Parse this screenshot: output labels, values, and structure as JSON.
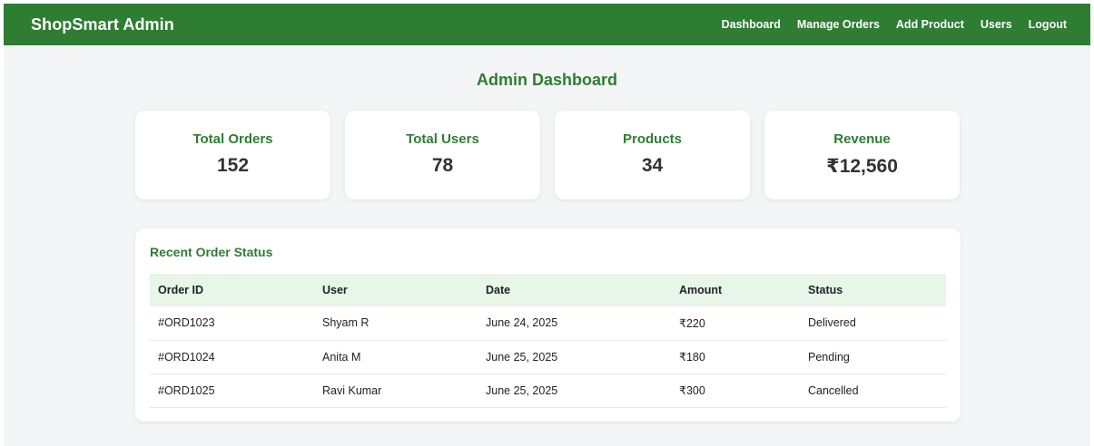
{
  "navbar": {
    "brand": "ShopSmart Admin",
    "links": [
      "Dashboard",
      "Manage Orders",
      "Add Product",
      "Users",
      "Logout"
    ]
  },
  "page": {
    "title": "Admin Dashboard"
  },
  "stats": [
    {
      "label": "Total Orders",
      "value": "152"
    },
    {
      "label": "Total Users",
      "value": "78"
    },
    {
      "label": "Products",
      "value": "34"
    },
    {
      "label": "Revenue",
      "value": "₹12,560"
    }
  ],
  "orders": {
    "title": "Recent Order Status",
    "columns": [
      "Order ID",
      "User",
      "Date",
      "Amount",
      "Status"
    ],
    "rows": [
      [
        "#ORD1023",
        "Shyam R",
        "June 24, 2025",
        "₹220",
        "Delivered"
      ],
      [
        "#ORD1024",
        "Anita M",
        "June 25, 2025",
        "₹180",
        "Pending"
      ],
      [
        "#ORD1025",
        "Ravi Kumar",
        "June 25, 2025",
        "₹300",
        "Cancelled"
      ]
    ]
  },
  "colors": {
    "brand_green": "#2e7d32",
    "table_header_bg": "#e8f5e9",
    "page_bg": "#f4f5f7"
  }
}
